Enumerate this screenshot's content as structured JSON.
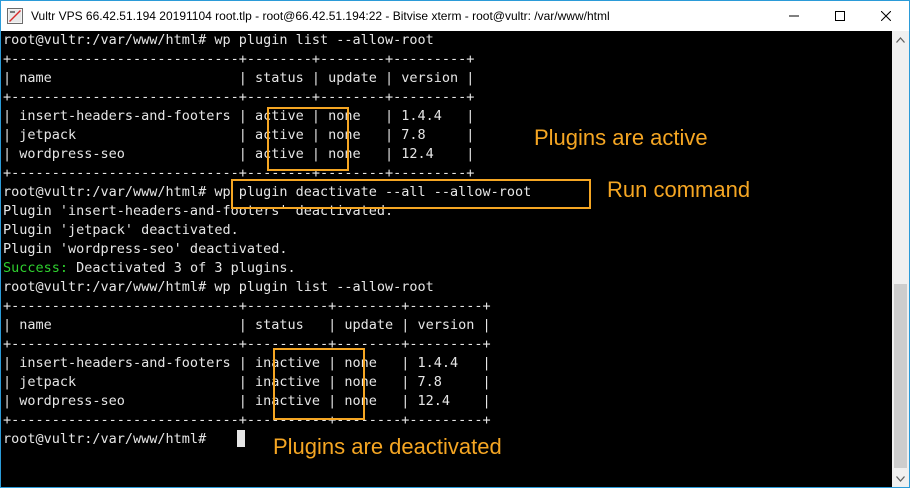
{
  "window": {
    "title": "Vultr VPS 66.42.51.194 20191104 root.tlp - root@66.42.51.194:22 - Bitvise xterm - root@vultr: /var/www/html",
    "app_icon": "bitvise-terminal-icon",
    "buttons": {
      "minimize": "minimize-icon",
      "maximize": "maximize-icon",
      "close": "close-icon"
    }
  },
  "terminal": {
    "lines": [
      "root@vultr:/var/www/html# wp plugin list --allow-root",
      "+----------------------------+--------+--------+---------+",
      "| name                       | status | update | version |",
      "+----------------------------+--------+--------+---------+",
      "| insert-headers-and-footers | active | none   | 1.4.4   |",
      "| jetpack                    | active | none   | 7.8     |",
      "| wordpress-seo              | active | none   | 12.4    |",
      "+----------------------------+--------+--------+---------+",
      "root@vultr:/var/www/html# wp plugin deactivate --all --allow-root",
      "Plugin 'insert-headers-and-footers' deactivated.",
      "Plugin 'jetpack' deactivated.",
      "Plugin 'wordpress-seo' deactivated.",
      "Deactivated 3 of 3 plugins.",
      "root@vultr:/var/www/html# wp plugin list --allow-root",
      "+----------------------------+----------+--------+---------+",
      "| name                       | status   | update | version |",
      "+----------------------------+----------+--------+---------+",
      "| insert-headers-and-footers | inactive | none   | 1.4.4   |",
      "| jetpack                    | inactive | none   | 7.8     |",
      "| wordpress-seo              | inactive | none   | 12.4    |",
      "+----------------------------+----------+--------+---------+",
      "root@vultr:/var/www/html# "
    ],
    "success_prefix": "Success: ",
    "success_color": "#2fd12f",
    "text_color": "#e6e6e6"
  },
  "annotations": {
    "color": "#f5a623",
    "plugins_active": "Plugins are active",
    "run_command": "Run command",
    "plugins_deactivated": "Plugins are deactivated"
  }
}
